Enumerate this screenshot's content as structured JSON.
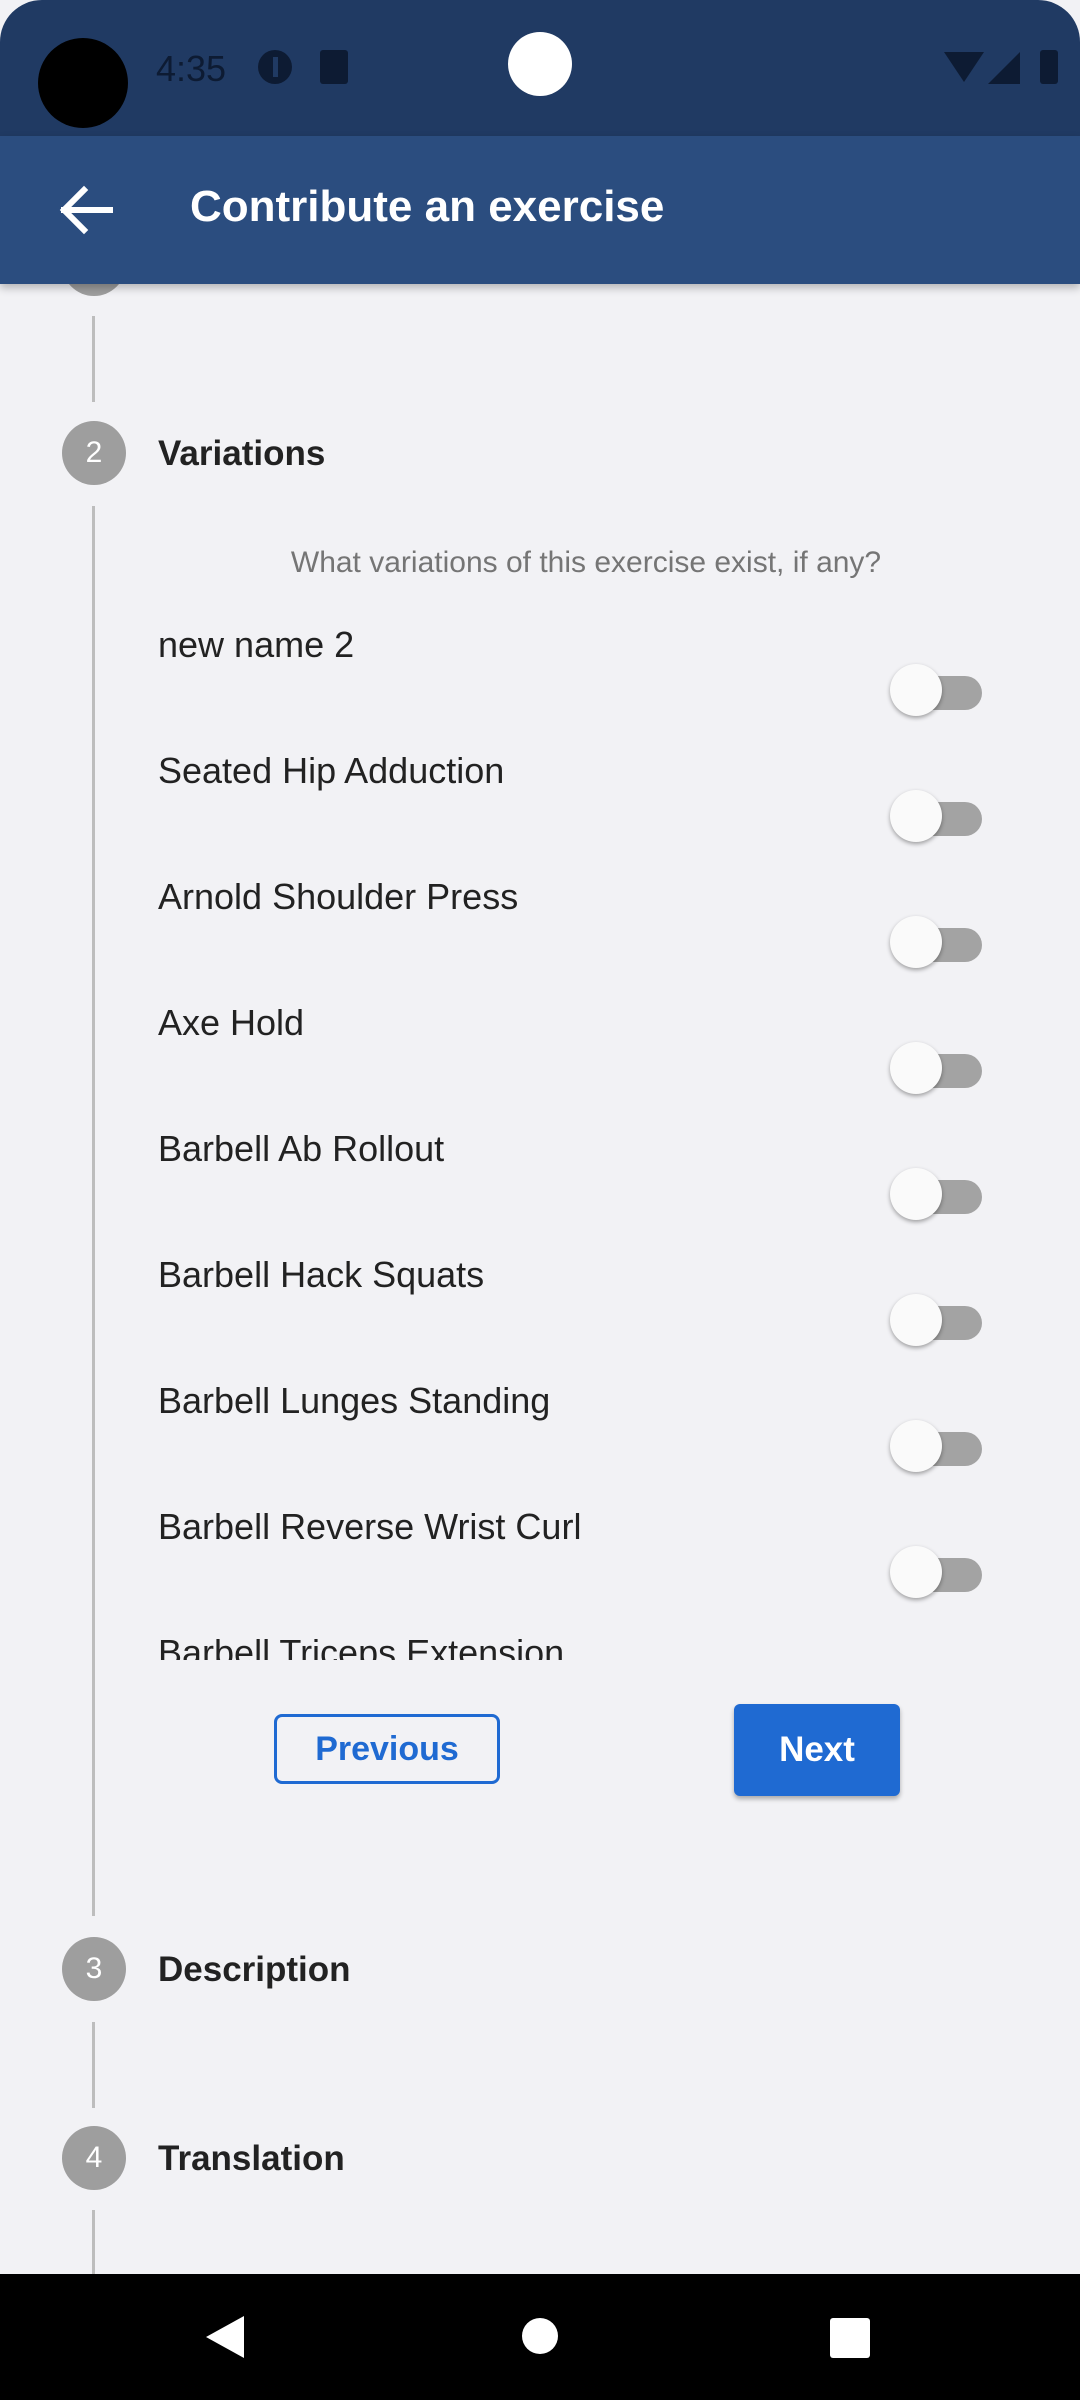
{
  "status_bar": {
    "time": "4:35"
  },
  "app_bar": {
    "title": "Contribute an exercise"
  },
  "steps": [
    {
      "number": "2",
      "title": "Variations"
    },
    {
      "number": "3",
      "title": "Description"
    },
    {
      "number": "4",
      "title": "Translation"
    }
  ],
  "variations": {
    "question": "What variations of this exercise exist, if any?",
    "items": [
      {
        "label": "new name 2",
        "enabled": false
      },
      {
        "label": "Seated Hip Adduction",
        "enabled": false
      },
      {
        "label": "Arnold Shoulder Press",
        "enabled": false
      },
      {
        "label": "Axe Hold",
        "enabled": false
      },
      {
        "label": "Barbell Ab Rollout",
        "enabled": false
      },
      {
        "label": "Barbell Hack Squats",
        "enabled": false
      },
      {
        "label": "Barbell Lunges Standing",
        "enabled": false
      },
      {
        "label": "Barbell Reverse Wrist Curl",
        "enabled": false
      },
      {
        "label": "Barbell Triceps Extension",
        "enabled": false
      }
    ]
  },
  "buttons": {
    "previous": "Previous",
    "next": "Next"
  },
  "colors": {
    "status_bar": "#203a63",
    "app_bar": "#2b4d7f",
    "accent": "#1f6ad2",
    "background": "#f2f2f5"
  }
}
